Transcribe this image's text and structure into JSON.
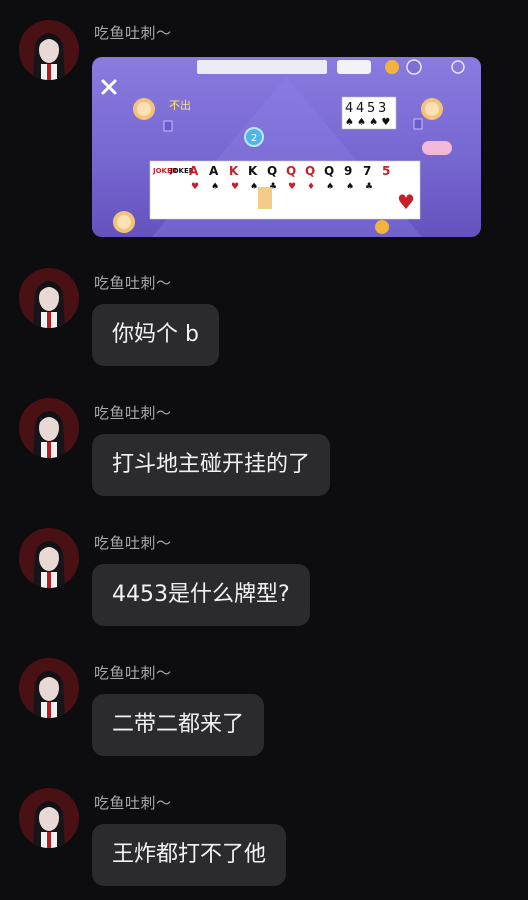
{
  "messages": [
    {
      "sender": "吃鱼吐刺〜",
      "type": "image"
    },
    {
      "sender": "吃鱼吐刺〜",
      "type": "text",
      "text": "你妈个 b"
    },
    {
      "sender": "吃鱼吐刺〜",
      "type": "text",
      "text": "打斗地主碰开挂的了"
    },
    {
      "sender": "吃鱼吐刺〜",
      "type": "text",
      "text": "4453是什么牌型?"
    },
    {
      "sender": "吃鱼吐刺〜",
      "type": "text",
      "text": "二带二都来了"
    },
    {
      "sender": "吃鱼吐刺〜",
      "type": "text",
      "text": "王炸都打不了他"
    }
  ],
  "game": {
    "pass_label": "不出",
    "played_cards": [
      "4",
      "4",
      "5",
      "3"
    ],
    "hand_cards": [
      "JOKER",
      "JOKER",
      "A",
      "A",
      "K",
      "K",
      "Q",
      "Q",
      "Q",
      "Q",
      "9",
      "7",
      "5"
    ],
    "countdown": "2"
  },
  "colors": {
    "background": "#0d0d10",
    "bubble": "#2b2b2f",
    "name": "#a7a7ad",
    "game_bg": "#7d6fd6"
  }
}
